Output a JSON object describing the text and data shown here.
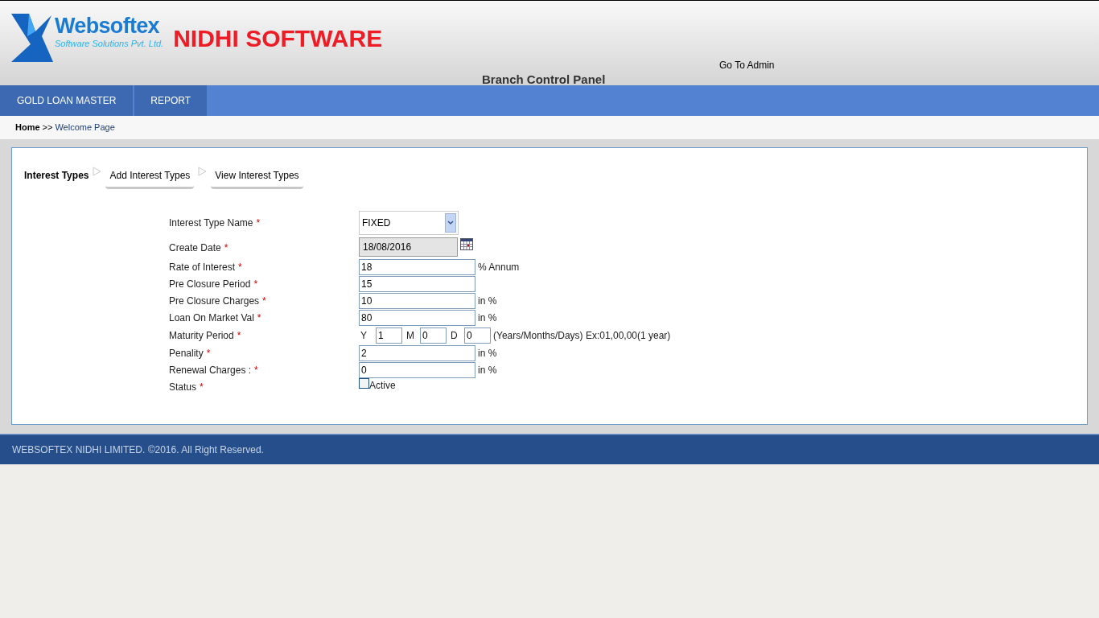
{
  "header": {
    "brand": "Websoftex",
    "brand_tagline": "Software Solutions Pvt. Ltd.",
    "product": "NIDHI SOFTWARE",
    "admin_link": "Go To Admin",
    "panel_title": "Branch Control Panel"
  },
  "nav": [
    "GOLD LOAN MASTER",
    "REPORT"
  ],
  "breadcrumb": {
    "home": "Home",
    "separator": ">>",
    "current": "Welcome Page"
  },
  "steps": [
    {
      "label": "Interest Types",
      "kind": "title"
    },
    {
      "label": "Add Interest Types",
      "kind": "tab"
    },
    {
      "label": "View Interest Types",
      "kind": "tab"
    }
  ],
  "form": [
    {
      "kind": "select",
      "label": "Interest Type Name",
      "mark": "*",
      "value": "FIXED"
    },
    {
      "kind": "date",
      "label": "Create Date",
      "mark": "*",
      "value": "18/08/2016"
    },
    {
      "kind": "text",
      "label": "Rate of Interest",
      "mark": "*",
      "value": "18",
      "suffix": "% Annum"
    },
    {
      "kind": "text",
      "label": "Pre Closure Period",
      "mark": "*",
      "value": "15"
    },
    {
      "kind": "text",
      "label": "Pre Closure Charges",
      "mark": "*",
      "value": "10",
      "suffix": "in %"
    },
    {
      "kind": "text",
      "label": "Loan On Market Val",
      "mark": "*",
      "value": "80",
      "suffix": "in %"
    },
    {
      "kind": "maturity",
      "label": "Maturity Period",
      "mark": "*",
      "parts": [
        {
          "unit": "Y",
          "value": "1"
        },
        {
          "unit": "M",
          "value": "0"
        },
        {
          "unit": "D",
          "value": "0"
        }
      ],
      "suffix": "(Years/Months/Days) Ex:01,00,00(1 year)"
    },
    {
      "kind": "text",
      "label": "Penality",
      "mark": "*",
      "value": "2",
      "suffix": "in %"
    },
    {
      "kind": "text",
      "label": "Renewal Charges :",
      "mark": "*",
      "value": "0",
      "suffix": "in %"
    },
    {
      "kind": "checkbox",
      "label": "Status",
      "mark": "*",
      "checked": false,
      "option": "Active"
    }
  ],
  "footer": "WEBSOFTEX NIDHI LIMITED. ©2016. All Right Reserved."
}
